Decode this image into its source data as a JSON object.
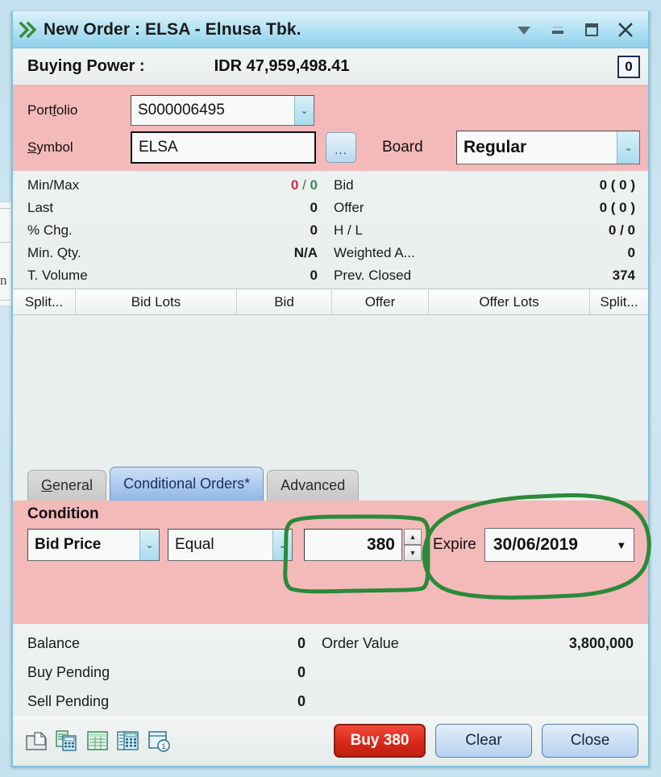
{
  "window": {
    "title": "New Order : ELSA - Elnusa Tbk.",
    "menu_icon": "double-chevron-icon",
    "controls": [
      {
        "name": "dropdown-menu",
        "glyph": "▼"
      },
      {
        "name": "minimize",
        "glyph": "—"
      },
      {
        "name": "maximize",
        "glyph": "❐"
      },
      {
        "name": "close",
        "glyph": "✕"
      }
    ]
  },
  "buying_power": {
    "label": "Buying Power :",
    "value": "IDR 47,959,498.41",
    "badge": "0"
  },
  "form": {
    "portfolio_label": "Portfolio",
    "portfolio_value": "S000006495",
    "symbol_label": "Symbol",
    "symbol_value": "ELSA",
    "browse_label": "...",
    "board_label": "Board",
    "board_value": "Regular"
  },
  "quotes": [
    {
      "label_left": "Min/Max",
      "value_left": "0 / 0",
      "min": "0",
      "max": "0",
      "label_right": "Bid",
      "value_right": "0 ( 0 )"
    },
    {
      "label_left": "Last",
      "value_left": "0",
      "label_right": "Offer",
      "value_right": "0 ( 0 )"
    },
    {
      "label_left": "% Chg.",
      "value_left": "0",
      "label_right": "H / L",
      "value_right": "0 / 0"
    },
    {
      "label_left": "Min. Qty.",
      "value_left": "N/A",
      "label_right": "Weighted A...",
      "value_right": "0"
    },
    {
      "label_left": "T. Volume",
      "value_left": "0",
      "label_right": "Prev. Closed",
      "value_right": "374"
    }
  ],
  "depth": {
    "columns": [
      "Split...",
      "Bid Lots",
      "Bid",
      "Offer",
      "Offer Lots",
      "Split..."
    ],
    "rows": []
  },
  "tabs": [
    {
      "label": "General",
      "active": false
    },
    {
      "label": "Conditional Orders*",
      "active": true
    },
    {
      "label": "Advanced",
      "active": false
    }
  ],
  "condition": {
    "title": "Condition",
    "field": "Bid Price",
    "operator": "Equal",
    "value": "380",
    "expire_label": "Expire",
    "expire_value": "30/06/2019",
    "spin_up": "▲",
    "spin_down": "▼"
  },
  "balances": [
    {
      "label_left": "Balance",
      "value_left": "0",
      "label_right": "Order Value",
      "value_right": "3,800,000"
    },
    {
      "label_left": "Buy Pending",
      "value_left": "0",
      "label_right": "",
      "value_right": ""
    },
    {
      "label_left": "Sell Pending",
      "value_left": "0",
      "label_right": "",
      "value_right": ""
    }
  ],
  "toolbar_icons": [
    "open-document-icon",
    "order-calculator-icon",
    "spreadsheet-icon",
    "calculator-panel-icon",
    "calendar-day-icon"
  ],
  "actions": {
    "buy_label": "Buy 380",
    "clear_label": "Clear",
    "close_label": "Close"
  },
  "annotations": {
    "color": "#2a8a3a",
    "shapes": [
      "rect-around-condition-value",
      "ellipse-around-expire-date"
    ]
  },
  "colors": {
    "pink_panel": "#f4b9b9",
    "titlebar": "#9ed7ee",
    "buy_red": "#d8291a",
    "annotation_green": "#2a8a3a",
    "min_red": "#c0304a",
    "max_green": "#3a8a50"
  },
  "background_window": {
    "ghost_text": "n"
  }
}
